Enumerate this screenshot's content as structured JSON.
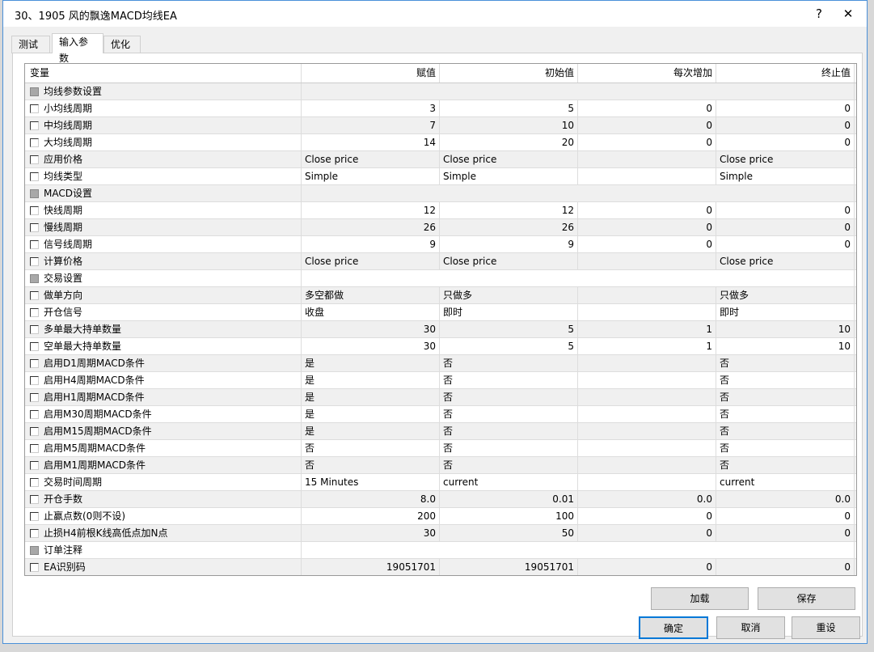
{
  "window": {
    "title": "30、1905 风的飘逸MACD均线EA",
    "help": "?",
    "close": "✕"
  },
  "tabs": [
    {
      "label": "测试"
    },
    {
      "label": "输入参数",
      "active": true
    },
    {
      "label": "优化"
    }
  ],
  "columns": [
    "变量",
    "赋值",
    "初始值",
    "每次增加",
    "终止值"
  ],
  "rows": [
    {
      "name": "均线参数设置",
      "group": true,
      "v": [
        "",
        "",
        "",
        ""
      ]
    },
    {
      "name": "小均线周期",
      "v": [
        "3",
        "5",
        "0",
        "0"
      ],
      "num": true
    },
    {
      "name": "中均线周期",
      "v": [
        "7",
        "10",
        "0",
        "0"
      ],
      "num": true
    },
    {
      "name": "大均线周期",
      "v": [
        "14",
        "20",
        "0",
        "0"
      ],
      "num": true
    },
    {
      "name": "应用价格",
      "v": [
        "Close price",
        "Close price",
        "",
        "Close price"
      ]
    },
    {
      "name": "均线类型",
      "v": [
        "Simple",
        "Simple",
        "",
        "Simple"
      ]
    },
    {
      "name": "MACD设置",
      "group": true,
      "v": [
        "",
        "",
        "",
        ""
      ]
    },
    {
      "name": "快线周期",
      "v": [
        "12",
        "12",
        "0",
        "0"
      ],
      "num": true
    },
    {
      "name": "慢线周期",
      "v": [
        "26",
        "26",
        "0",
        "0"
      ],
      "num": true
    },
    {
      "name": "信号线周期",
      "v": [
        "9",
        "9",
        "0",
        "0"
      ],
      "num": true
    },
    {
      "name": "计算价格",
      "v": [
        "Close price",
        "Close price",
        "",
        "Close price"
      ]
    },
    {
      "name": "交易设置",
      "group": true,
      "v": [
        "",
        "",
        "",
        ""
      ]
    },
    {
      "name": "做单方向",
      "v": [
        "多空都做",
        "只做多",
        "",
        "只做多"
      ]
    },
    {
      "name": "开仓信号",
      "v": [
        "收盘",
        "即时",
        "",
        "即时"
      ]
    },
    {
      "name": "多单最大持单数量",
      "v": [
        "30",
        "5",
        "1",
        "10"
      ],
      "num": true
    },
    {
      "name": "空单最大持单数量",
      "v": [
        "30",
        "5",
        "1",
        "10"
      ],
      "num": true
    },
    {
      "name": "启用D1周期MACD条件",
      "v": [
        "是",
        "否",
        "",
        "否"
      ]
    },
    {
      "name": "启用H4周期MACD条件",
      "v": [
        "是",
        "否",
        "",
        "否"
      ]
    },
    {
      "name": "启用H1周期MACD条件",
      "v": [
        "是",
        "否",
        "",
        "否"
      ]
    },
    {
      "name": "启用M30周期MACD条件",
      "v": [
        "是",
        "否",
        "",
        "否"
      ]
    },
    {
      "name": "启用M15周期MACD条件",
      "v": [
        "是",
        "否",
        "",
        "否"
      ]
    },
    {
      "name": "启用M5周期MACD条件",
      "v": [
        "否",
        "否",
        "",
        "否"
      ]
    },
    {
      "name": "启用M1周期MACD条件",
      "v": [
        "否",
        "否",
        "",
        "否"
      ]
    },
    {
      "name": "交易时间周期",
      "v": [
        "15 Minutes",
        "current",
        "",
        "current"
      ]
    },
    {
      "name": "开仓手数",
      "v": [
        "8.0",
        "0.01",
        "0.0",
        "0.0"
      ],
      "num": true
    },
    {
      "name": "止赢点数(0则不设)",
      "v": [
        "200",
        "100",
        "0",
        "0"
      ],
      "num": true
    },
    {
      "name": "止损H4前根K线高低点加N点",
      "v": [
        "30",
        "50",
        "0",
        "0"
      ],
      "num": true
    },
    {
      "name": "订单注释",
      "group": true,
      "v": [
        "",
        "",
        "",
        ""
      ]
    },
    {
      "name": "EA识别码",
      "v": [
        "19051701",
        "19051701",
        "0",
        "0"
      ],
      "num": true
    }
  ],
  "buttons": {
    "load": "加载",
    "save": "保存",
    "ok": "确定",
    "cancel": "取消",
    "reset": "重设"
  }
}
